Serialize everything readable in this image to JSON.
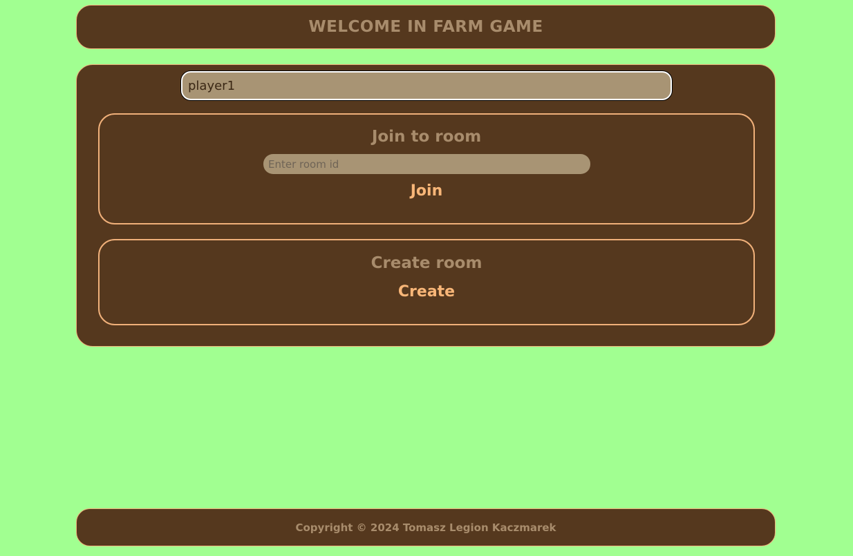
{
  "header": {
    "title": "WELCOME IN FARM GAME"
  },
  "player": {
    "name_value": "player1"
  },
  "join_room": {
    "title": "Join to room",
    "room_id_placeholder": "Enter room id",
    "room_id_value": "",
    "button_label": "Join"
  },
  "create_room": {
    "title": "Create room",
    "button_label": "Create"
  },
  "footer": {
    "copyright": "Copyright © 2024 Tomasz Legion Kaczmarek"
  },
  "colors": {
    "page_background": "#a1ff91",
    "panel_background": "#55381e",
    "panel_border": "#f0b07a",
    "muted_text": "#a88c6c",
    "button_text": "#f8b678",
    "input_background": "#a89474"
  }
}
